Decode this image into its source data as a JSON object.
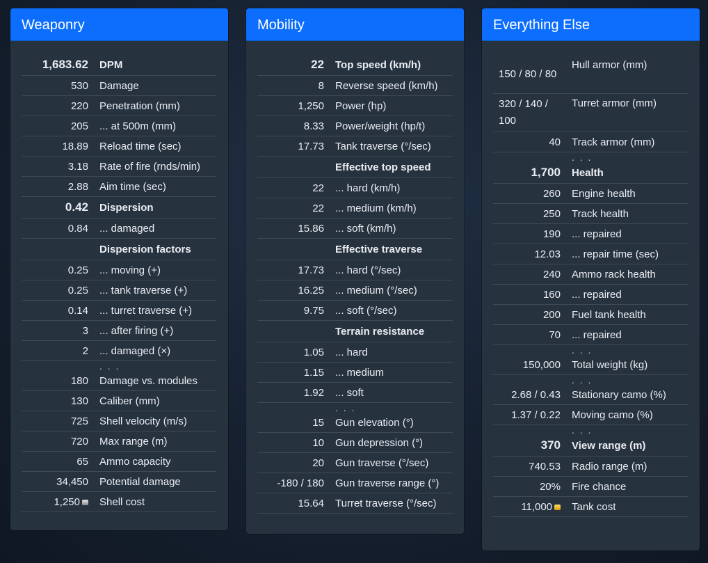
{
  "weaponry": {
    "title": "Weaponry",
    "rows": [
      {
        "value": "1,683.62",
        "label": "DPM",
        "style": "bold"
      },
      {
        "value": "530",
        "label": "Damage"
      },
      {
        "value": "220",
        "label": "Penetration (mm)"
      },
      {
        "value": "205",
        "label": "... at 500m (mm)"
      },
      {
        "value": "18.89",
        "label": "Reload time (sec)"
      },
      {
        "value": "3.18",
        "label": "Rate of fire (rnds/min)"
      },
      {
        "value": "2.88",
        "label": "Aim time (sec)"
      },
      {
        "value": "0.42",
        "label": "Dispersion",
        "style": "bold"
      },
      {
        "value": "0.84",
        "label": "... damaged"
      },
      {
        "value": "",
        "label": "Dispersion factors",
        "style": "hdr"
      },
      {
        "value": "0.25",
        "label": "... moving (+)"
      },
      {
        "value": "0.25",
        "label": "... tank traverse (+)"
      },
      {
        "value": "0.14",
        "label": "... turret traverse (+)"
      },
      {
        "value": "3",
        "label": "... after firing (+)"
      },
      {
        "value": "2",
        "label": "... damaged (×)"
      },
      {
        "value": "",
        "label": ". . .",
        "style": "dots"
      },
      {
        "value": "180",
        "label": "Damage vs. modules"
      },
      {
        "value": "130",
        "label": "Caliber (mm)"
      },
      {
        "value": "725",
        "label": "Shell velocity (m/s)"
      },
      {
        "value": "720",
        "label": "Max range (m)"
      },
      {
        "value": "65",
        "label": "Ammo capacity"
      },
      {
        "value": "34,450",
        "label": "Potential damage"
      },
      {
        "value": "1,250",
        "label": "Shell cost",
        "coin": "silver"
      }
    ]
  },
  "mobility": {
    "title": "Mobility",
    "rows": [
      {
        "value": "22",
        "label": "Top speed (km/h)",
        "style": "bold"
      },
      {
        "value": "8",
        "label": "Reverse speed (km/h)"
      },
      {
        "value": "1,250",
        "label": "Power (hp)"
      },
      {
        "value": "8.33",
        "label": "Power/weight (hp/t)"
      },
      {
        "value": "17.73",
        "label": "Tank traverse (°/sec)"
      },
      {
        "value": "",
        "label": "Effective top speed",
        "style": "hdr"
      },
      {
        "value": "22",
        "label": "... hard (km/h)"
      },
      {
        "value": "22",
        "label": "... medium (km/h)"
      },
      {
        "value": "15.86",
        "label": "... soft (km/h)"
      },
      {
        "value": "",
        "label": "Effective traverse",
        "style": "hdr"
      },
      {
        "value": "17.73",
        "label": "... hard (°/sec)"
      },
      {
        "value": "16.25",
        "label": "... medium (°/sec)"
      },
      {
        "value": "9.75",
        "label": "... soft (°/sec)"
      },
      {
        "value": "",
        "label": "Terrain resistance",
        "style": "hdr"
      },
      {
        "value": "1.05",
        "label": "... hard"
      },
      {
        "value": "1.15",
        "label": "... medium"
      },
      {
        "value": "1.92",
        "label": "... soft"
      },
      {
        "value": "",
        "label": ". . .",
        "style": "dots"
      },
      {
        "value": "15",
        "label": "Gun elevation (°)"
      },
      {
        "value": "10",
        "label": "Gun depression (°)"
      },
      {
        "value": "20",
        "label": "Gun traverse (°/sec)"
      },
      {
        "value": "-180 / 180",
        "label": "Gun traverse range (°)"
      },
      {
        "value": "15.64",
        "label": "Turret traverse (°/sec)"
      }
    ]
  },
  "everything_else": {
    "title": "Everything Else",
    "rows": [
      {
        "value": "150 / 80 / 80",
        "label": "Hull armor (mm)",
        "style": "wrap"
      },
      {
        "value": "320 / 140 / 100",
        "label": "Turret armor (mm)",
        "style": "wrap"
      },
      {
        "value": "40",
        "label": "Track armor (mm)"
      },
      {
        "value": "",
        "label": ". . .",
        "style": "dots"
      },
      {
        "value": "1,700",
        "label": "Health",
        "style": "bold"
      },
      {
        "value": "260",
        "label": "Engine health"
      },
      {
        "value": "250",
        "label": "Track health"
      },
      {
        "value": "190",
        "label": "... repaired"
      },
      {
        "value": "12.03",
        "label": "... repair time (sec)"
      },
      {
        "value": "240",
        "label": "Ammo rack health"
      },
      {
        "value": "160",
        "label": "... repaired"
      },
      {
        "value": "200",
        "label": "Fuel tank health"
      },
      {
        "value": "70",
        "label": "... repaired"
      },
      {
        "value": "",
        "label": ". . .",
        "style": "dots"
      },
      {
        "value": "150,000",
        "label": "Total weight (kg)"
      },
      {
        "value": "",
        "label": ". . .",
        "style": "dots"
      },
      {
        "value": "2.68 / 0.43",
        "label": "Stationary camo (%)"
      },
      {
        "value": "1.37 / 0.22",
        "label": "Moving camo (%)"
      },
      {
        "value": "",
        "label": ". . .",
        "style": "dots"
      },
      {
        "value": "370",
        "label": "View range (m)",
        "style": "bold"
      },
      {
        "value": "740.53",
        "label": "Radio range (m)"
      },
      {
        "value": "20%",
        "label": "Fire chance"
      },
      {
        "value": "11,000",
        "label": "Tank cost",
        "coin": "gold"
      }
    ]
  }
}
